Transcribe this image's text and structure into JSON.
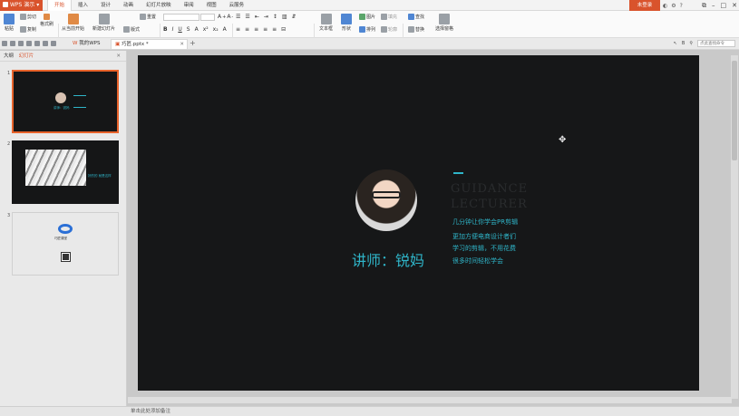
{
  "titlebar": {
    "app_name": "WPS 演示",
    "tabs": [
      "开始",
      "插入",
      "设计",
      "动画",
      "幻灯片放映",
      "审阅",
      "视图",
      "云服务"
    ],
    "active_tab": "开始",
    "login_label": "未登录",
    "accent": "#d9532c"
  },
  "ribbon": {
    "paste": "粘贴",
    "cut": "剪切",
    "copy": "复制",
    "format_painter": "格式刷",
    "play_from_start": "从当前开始",
    "new_slide": "新建幻灯片",
    "layout": "版式",
    "reset": "重置",
    "textbox": "文本框",
    "shape": "形状",
    "picture": "图片",
    "arrange": "排列",
    "fill": "填充",
    "outline": "轮廓",
    "find": "查找",
    "replace": "替换",
    "select_pane": "选择窗格"
  },
  "docbar": {
    "tab1": "我的WPS",
    "tab2": "巧匠.pptx *",
    "search_placeholder": "点此查找命令"
  },
  "leftpanel": {
    "outline_label": "大纲",
    "slides_label": "幻灯片",
    "slide_numbers": [
      "1",
      "2",
      "3"
    ],
    "thumb1_name": "讲师：锐妈",
    "thumb2_text": "好的的 就是这样",
    "thumb3_text": "巧匠课堂"
  },
  "slide": {
    "lecturer": "讲师：锐妈",
    "ghost_line1": "GUIDANCE",
    "ghost_line2": "LECTURER",
    "caption1": "几分钟让你学会PR剪辑",
    "caption2": "更加方便电商设计者们",
    "caption3": "学习的剪辑，不用花费",
    "caption4": "很多时间轻松学会",
    "text_color": "#2fb5c9",
    "background": "#161718"
  },
  "statusbar": {
    "note_placeholder": "单击此处添加备注"
  }
}
